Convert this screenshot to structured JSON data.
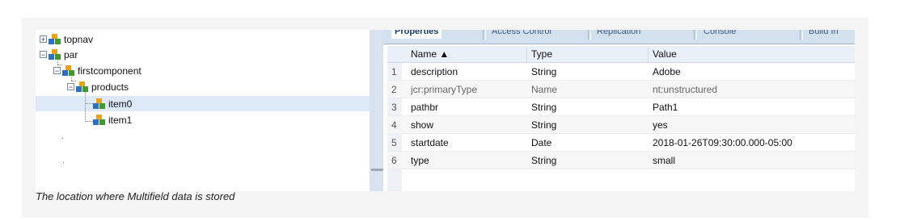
{
  "tree": {
    "nodes": [
      {
        "label": "topnav",
        "toggle": "+"
      },
      {
        "label": "par",
        "toggle": "−"
      },
      {
        "label": "firstcomponent",
        "toggle": "−"
      },
      {
        "label": "products",
        "toggle": "−"
      },
      {
        "label": "item0",
        "toggle": ""
      },
      {
        "label": "item1",
        "toggle": ""
      }
    ]
  },
  "tabs": [
    "Properties",
    "Access Control",
    "Replication",
    "Console",
    "Build In"
  ],
  "table": {
    "headers": {
      "name": "Name ▲",
      "type": "Type",
      "value": "Value"
    },
    "rows": [
      {
        "num": "1",
        "name": "description",
        "type": "String",
        "value": "Adobe"
      },
      {
        "num": "2",
        "name": "jcr:primaryType",
        "type": "Name",
        "value": "nt:unstructured"
      },
      {
        "num": "3",
        "name": "pathbr",
        "type": "String",
        "value": "Path1"
      },
      {
        "num": "4",
        "name": "show",
        "type": "String",
        "value": "yes"
      },
      {
        "num": "5",
        "name": "startdate",
        "type": "Date",
        "value": "2018-01-26T09:30:00.000-05:00"
      },
      {
        "num": "6",
        "name": "type",
        "type": "String",
        "value": "small"
      }
    ]
  },
  "caption": "The location where Multifield data is stored",
  "colors": {
    "selection": "#dde9f7",
    "tab_bar": "#d3e0ee",
    "figure_bg": "#f5f5f5"
  }
}
